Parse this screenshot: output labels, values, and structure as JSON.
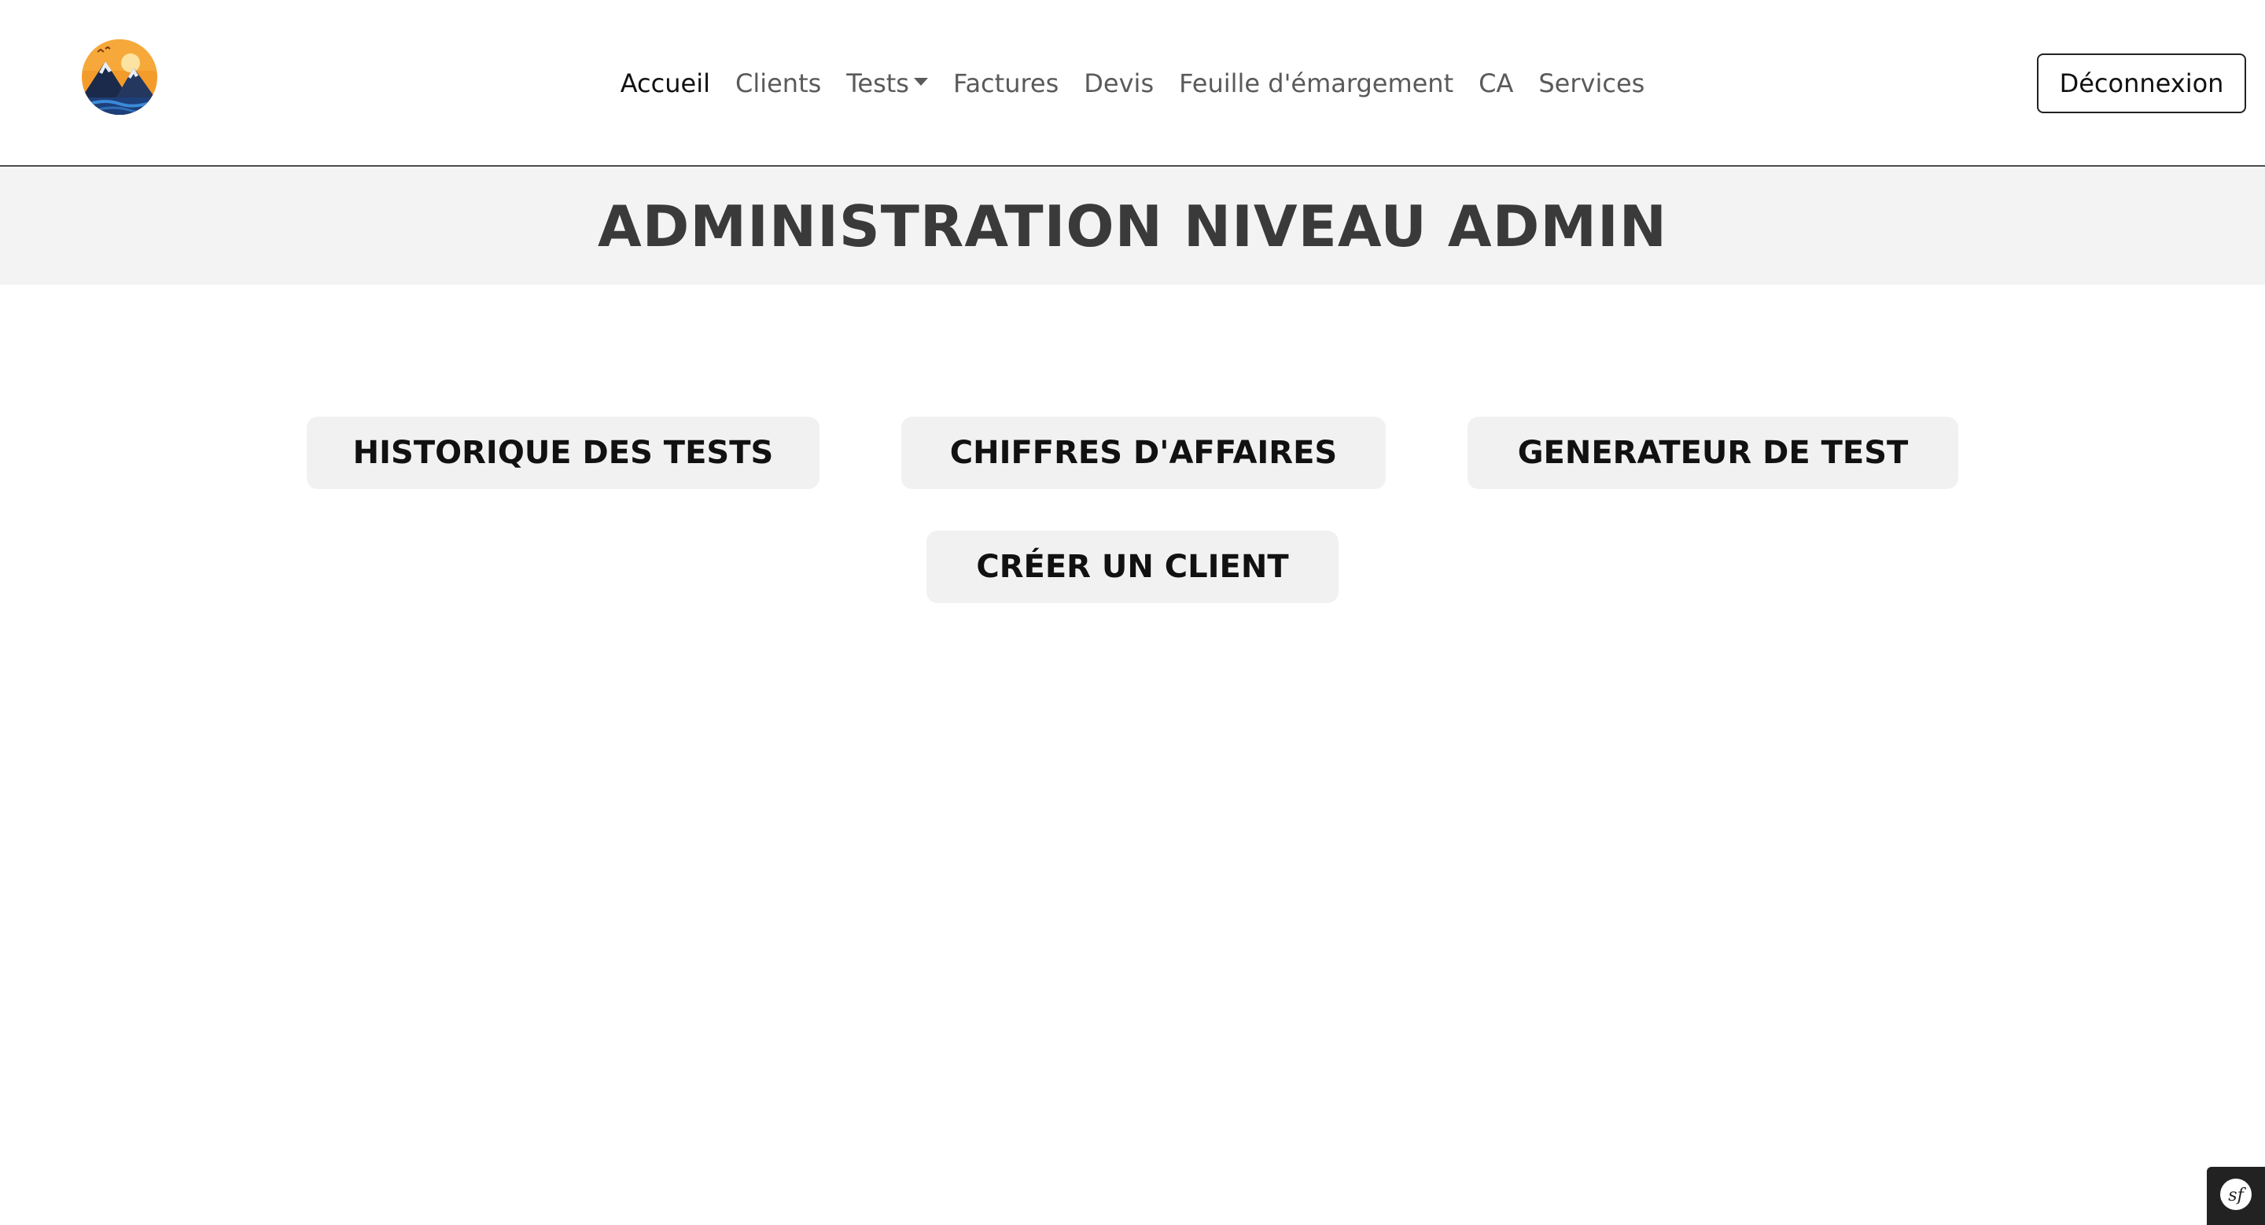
{
  "navbar": {
    "logo_icon": "mountain-sunset-logo-icon",
    "links": [
      {
        "label": "Accueil",
        "active": true
      },
      {
        "label": "Clients",
        "active": false
      },
      {
        "label": "Tests",
        "active": false,
        "dropdown": true
      },
      {
        "label": "Factures",
        "active": false
      },
      {
        "label": "Devis",
        "active": false
      },
      {
        "label": "Feuille d'émargement",
        "active": false
      },
      {
        "label": "CA",
        "active": false
      },
      {
        "label": "Services",
        "active": false
      }
    ],
    "logout_label": "Déconnexion"
  },
  "page": {
    "title": "ADMINISTRATION NIVEAU ADMIN"
  },
  "actions": {
    "historique": "HISTORIQUE DES TESTS",
    "chiffres": "CHIFFRES D'AFFAIRES",
    "generateur": "GENERATEUR DE TEST",
    "creer_client": "CRÉER UN CLIENT"
  },
  "debug_toolbar": {
    "icon": "symfony-sf-icon"
  },
  "colors": {
    "title_band": "#f3f3f3",
    "title_text": "#3a3a3a",
    "button_bg": "#f1f1f1",
    "nav_text": "#5a5a5a",
    "nav_active": "#111111",
    "logo_orange": "#f39c2b",
    "logo_navy": "#1b2a4a"
  }
}
